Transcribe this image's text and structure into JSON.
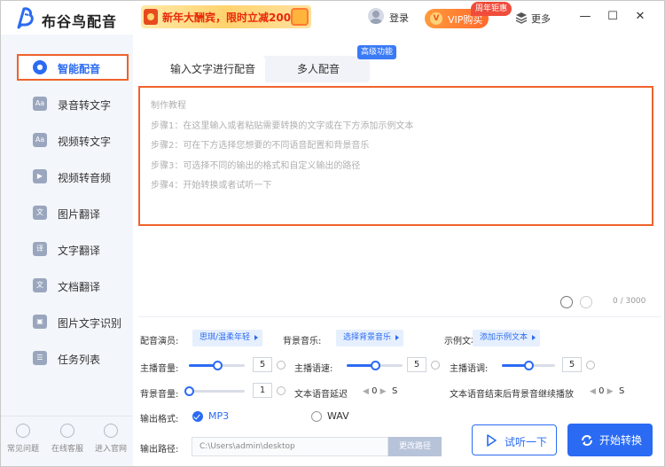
{
  "app": {
    "title": "布谷鸟配音",
    "promo_text": "新年大酬宾，限时立减200元",
    "login_label": "登录",
    "vip_label": "VIP购买",
    "vip_icon": "V",
    "anniversary_badge": "周年钜惠",
    "more_label": "更多",
    "window_controls": {
      "minimize": "—",
      "maximize": "☐",
      "close": "✕"
    }
  },
  "sidebar": {
    "items": [
      {
        "label": "智能配音",
        "icon": "mic-icon",
        "glyph": "🔍",
        "active": true
      },
      {
        "label": "录音转文字",
        "icon": "audio-text-icon",
        "glyph": "Aa",
        "active": false
      },
      {
        "label": "视频转文字",
        "icon": "video-text-icon",
        "glyph": "Aa",
        "active": false
      },
      {
        "label": "视频转音频",
        "icon": "video-audio-icon",
        "glyph": "▶",
        "active": false
      },
      {
        "label": "图片翻译",
        "icon": "image-translate-icon",
        "glyph": "文",
        "active": false
      },
      {
        "label": "文字翻译",
        "icon": "text-translate-icon",
        "glyph": "译",
        "active": false
      },
      {
        "label": "文档翻译",
        "icon": "doc-translate-icon",
        "glyph": "文",
        "active": false
      },
      {
        "label": "图片文字识别",
        "icon": "ocr-icon",
        "glyph": "▣",
        "active": false
      },
      {
        "label": "任务列表",
        "icon": "task-list-icon",
        "glyph": "☰",
        "active": false
      }
    ],
    "bottom": [
      {
        "label": "常见问题",
        "icon": "faq-icon"
      },
      {
        "label": "在线客服",
        "icon": "support-icon"
      },
      {
        "label": "进入官网",
        "icon": "website-icon"
      }
    ]
  },
  "tabs": {
    "input_text": "输入文字进行配音",
    "multi_voice": "多人配音",
    "advanced_badge": "高级功能"
  },
  "editor": {
    "lines": [
      "制作教程",
      "步骤1：在这里输入或者粘贴需要转换的文字或在下方添加示例文本",
      "步骤2：可在下方选择您想要的不同语音配置和背景音乐",
      "步骤3：可选择不同的输出的格式和自定义输出的路径",
      "步骤4：开始转换或者试听一下"
    ],
    "char_count": "0 / 3000"
  },
  "settings": {
    "voice_actor_label": "配音演员:",
    "voice_actor_value": "思琪/温柔年轻",
    "bg_music_label": "背景音乐:",
    "bg_music_value": "选择背景音乐",
    "sample_text_label": "示例文本:",
    "sample_text_value": "添加示例文本",
    "main_volume_label": "主播音量:",
    "main_volume_value": "5",
    "main_volume_level": 0.5,
    "speed_label": "主播语速:",
    "speed_value": "5",
    "speed_level": 0.5,
    "pitch_label": "主播语调:",
    "pitch_value": "5",
    "pitch_level": 0.5,
    "bg_volume_label": "背景音量:",
    "bg_volume_value": "1",
    "bg_volume_level": 0.0,
    "delay_label": "文本语音延迟",
    "delay_value": "0",
    "delay_unit": "S",
    "continue_label": "文本语音结束后背景音继续播放",
    "continue_value": "0",
    "continue_unit": "S",
    "format_label": "输出格式:",
    "format_mp3": "MP3",
    "format_wav": "WAV",
    "format_selected": "MP3",
    "path_label": "输出路径:",
    "path_value": "C:\\Users\\admin\\desktop",
    "change_path_label": "更改路径"
  },
  "actions": {
    "preview_label": "试听一下",
    "start_label": "开始转换"
  },
  "colors": {
    "accent": "#2b6bf3",
    "highlight_border": "#f0622c",
    "vip": "#ff7a2e",
    "sidebar_bg": "#f3f6fb"
  }
}
